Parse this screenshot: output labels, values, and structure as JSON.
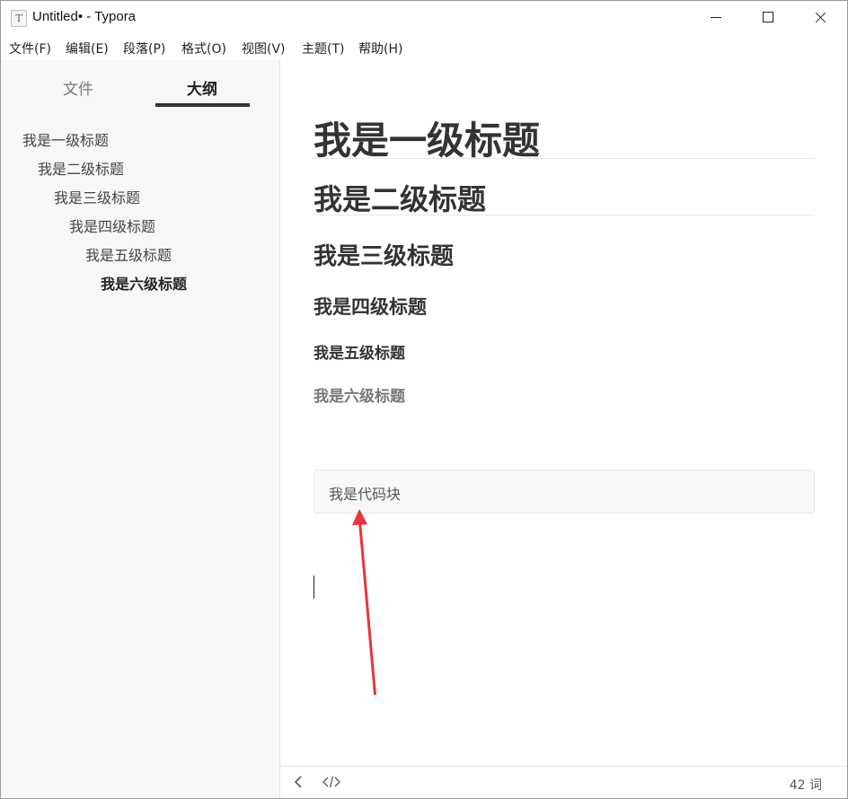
{
  "window": {
    "icon_glyph": "T",
    "title": "Untitled• - Typora"
  },
  "menu": {
    "items": [
      "文件(F)",
      "编辑(E)",
      "段落(P)",
      "格式(O)",
      "视图(V)",
      "主题(T)",
      "帮助(H)"
    ]
  },
  "sidebar": {
    "tabs": [
      {
        "label": "文件",
        "active": false
      },
      {
        "label": "大纲",
        "active": true
      }
    ],
    "outline": [
      {
        "label": "我是一级标题",
        "level": 1
      },
      {
        "label": "我是二级标题",
        "level": 2
      },
      {
        "label": "我是三级标题",
        "level": 3
      },
      {
        "label": "我是四级标题",
        "level": 4
      },
      {
        "label": "我是五级标题",
        "level": 5
      },
      {
        "label": "我是六级标题",
        "level": 6,
        "active": true
      }
    ]
  },
  "editor": {
    "headings": [
      {
        "level": 1,
        "text": "我是一级标题"
      },
      {
        "level": 2,
        "text": "我是二级标题"
      },
      {
        "level": 3,
        "text": "我是三级标题"
      },
      {
        "level": 4,
        "text": "我是四级标题"
      },
      {
        "level": 5,
        "text": "我是五级标题"
      },
      {
        "level": 6,
        "text": "我是六级标题"
      }
    ],
    "code_block": "我是代码块"
  },
  "annotation": {
    "color": "#e8343a"
  },
  "statusbar": {
    "back_icon": "chevron-left-icon",
    "source_icon": "code-icon",
    "word_count": "42 词"
  }
}
